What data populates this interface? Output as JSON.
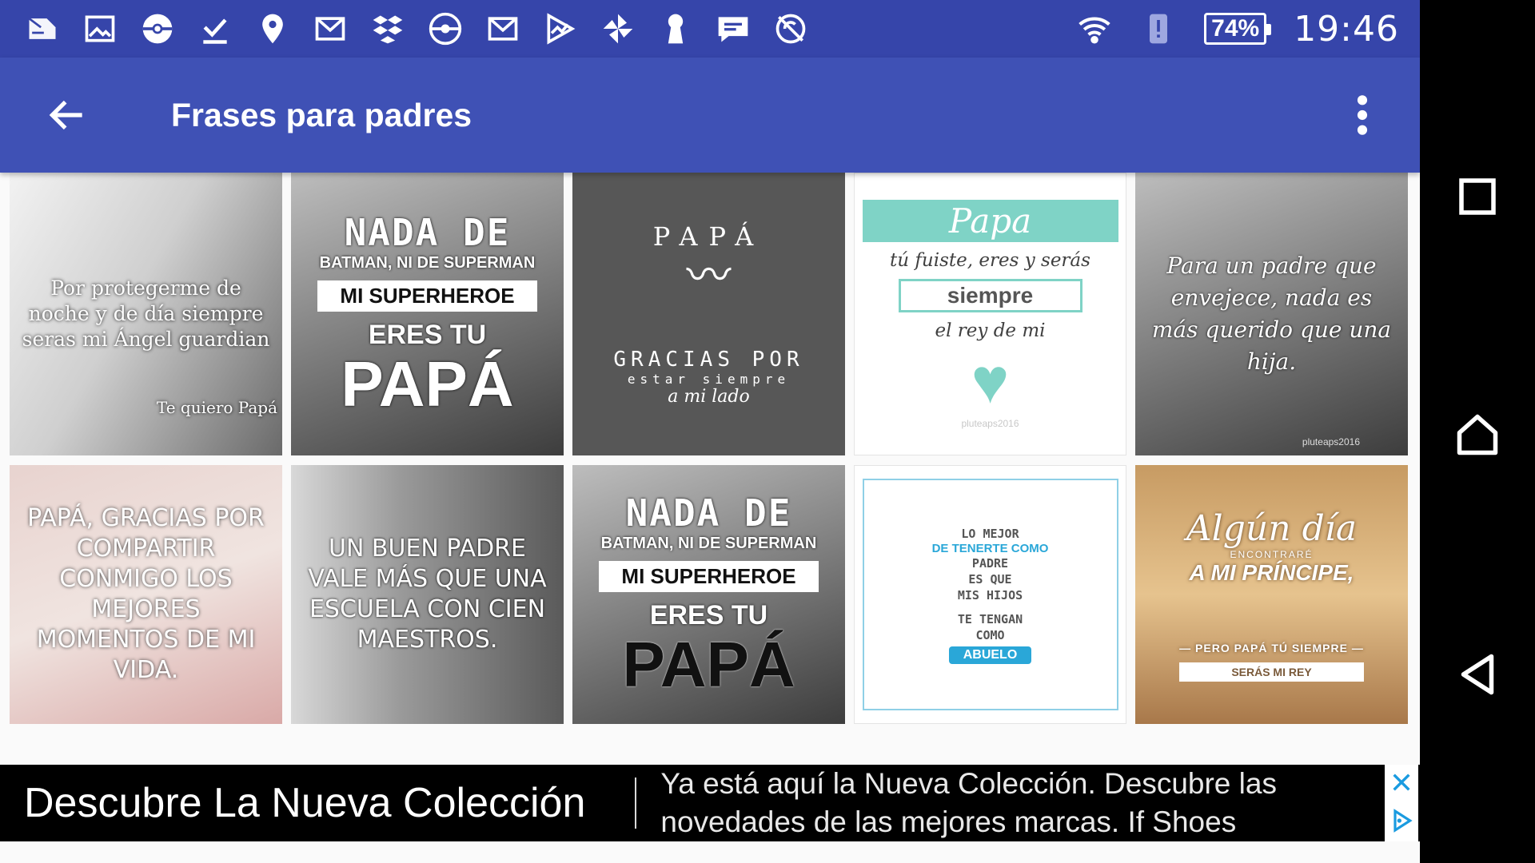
{
  "status_bar": {
    "notification_icons": [
      "news-icon",
      "gallery-icon",
      "pokeball-icon",
      "download-done-icon",
      "location-icon",
      "gmail-icon",
      "dropbox-icon",
      "pokeball-icon",
      "gmail-icon",
      "play-store-icon",
      "pinwheel-icon",
      "keyhole-icon",
      "chat-icon",
      "no-sync-icon"
    ],
    "battery": "74%",
    "time": "19:46"
  },
  "app_bar": {
    "title": "Frases para padres",
    "color": "#3f51b5",
    "status_color": "#3645aa"
  },
  "grid": {
    "tiles": [
      {
        "caption": "Por protegerme de noche y de día siempre seras mi Ángel guardian",
        "signature": "Te quiero Papá"
      },
      {
        "line1": "NADA DE",
        "line2": "BATMAN, NI DE SUPERMAN",
        "band": "MI SUPERHEROE",
        "line3": "ERES TU",
        "line4": "PAPÁ"
      },
      {
        "line1": "PAPÁ",
        "line2": "GRACIAS POR",
        "line3": "estar siempre",
        "line4": "a mi lado"
      },
      {
        "line1": "Papa",
        "line2": "tú fuiste, eres y serás",
        "band": "siempre",
        "line3": "el rey de mi",
        "watermark": "pluteaps2016"
      },
      {
        "caption": "Para un padre que envejece, nada es más querido que una hija.",
        "watermark": "pluteaps2016"
      },
      {
        "caption": "PAPÁ, GRACIAS POR COMPARTIR CONMIGO LOS MEJORES MOMENTOS DE MI VIDA."
      },
      {
        "caption": "UN BUEN PADRE VALE MÁS QUE UNA ESCUELA CON CIEN MAESTROS."
      },
      {
        "line1": "NADA DE",
        "line2": "BATMAN, NI DE SUPERMAN",
        "band": "MI SUPERHEROE",
        "line3": "ERES TU",
        "line4": "PAPÁ"
      },
      {
        "line1": "LO MEJOR",
        "line2": "DE TENERTE COMO",
        "line3": "PADRE",
        "line4": "ES QUE",
        "line5": "MIS HIJOS",
        "line6": "TE TENGAN",
        "line7": "COMO",
        "ribbon": "ABUELO"
      },
      {
        "line1": "Algún día",
        "line2": "ENCONTRARÉ",
        "line3": "A MI PRÍNCIPE,",
        "line4": "— PERO PAPÁ TÚ SIEMPRE —",
        "ribbon": "SERÁS MI REY"
      }
    ]
  },
  "ad": {
    "headline": "Descubre La Nueva Colección",
    "description": "Ya está aquí la Nueva Colección. Descubre las novedades de las mejores marcas. If Shoes"
  },
  "nav_bar": {
    "buttons": [
      "recents-icon",
      "home-icon",
      "back-icon"
    ]
  }
}
